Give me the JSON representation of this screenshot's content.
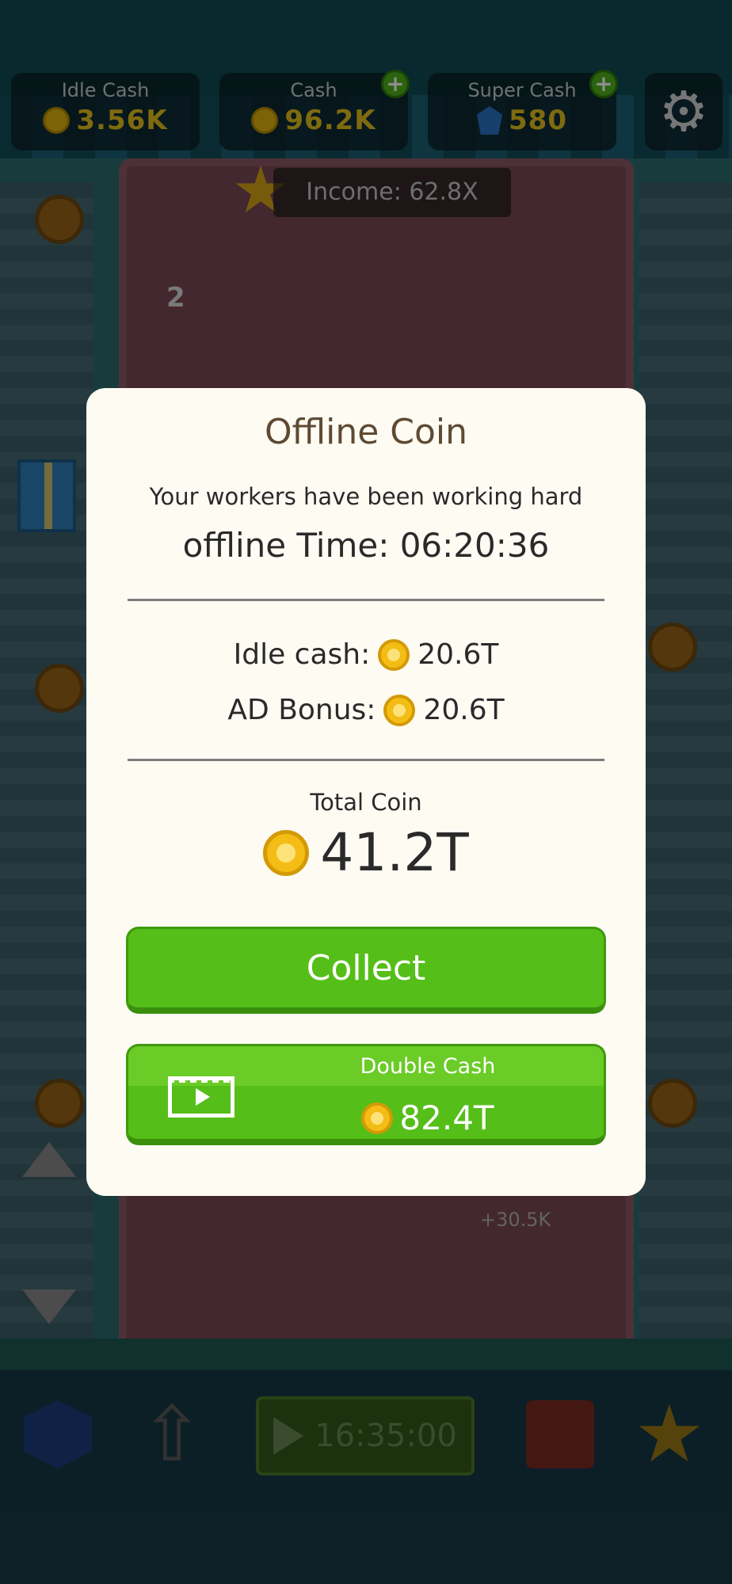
{
  "hud": {
    "idle_cash": {
      "label": "Idle Cash",
      "value": "3.56K"
    },
    "cash": {
      "label": "Cash",
      "value": "96.2K"
    },
    "super_cash": {
      "label": "Super Cash",
      "value": "580"
    },
    "plus_symbol": "+",
    "settings_icon": "gear-icon"
  },
  "income": {
    "text": "Income: 62.8X"
  },
  "floor_number": "2",
  "floating_text": "+30.5K",
  "dialog": {
    "title": "Offline Coin",
    "subtitle": "Your workers have been working hard",
    "offline_time": "offline Time: 06:20:36",
    "idle_cash": {
      "label": "Idle cash:",
      "value": "20.6T"
    },
    "ad_bonus": {
      "label": "AD Bonus:",
      "value": "20.6T"
    },
    "total_label": "Total Coin",
    "total_value": "41.2T",
    "collect_label": "Collect",
    "double_label": "Double Cash",
    "double_value": "82.4T"
  },
  "toolbar": {
    "timer": "16:35:00"
  },
  "colors": {
    "accent_green": "#55be18",
    "coin_gold": "#f4bd15",
    "hud_value_gold": "#e8c21c",
    "dialog_bg": "#fefbf3",
    "title_brown": "#5e4a33"
  }
}
